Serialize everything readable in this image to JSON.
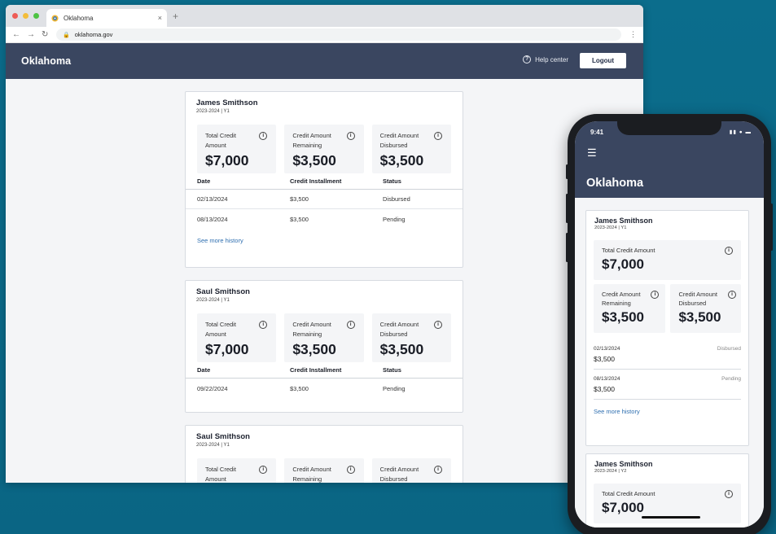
{
  "browser": {
    "tab_title": "Oklahoma",
    "tab_close": "×",
    "new_tab": "+",
    "url": "oklahoma.gov"
  },
  "header": {
    "brand": "Oklahoma",
    "help_label": "Help center",
    "logout_label": "Logout"
  },
  "labels": {
    "total_credit": "Total Credit Amount",
    "credit_remaining": "Credit Amount Remaining",
    "credit_disbursed": "Credit Amount Disbursed",
    "col_date": "Date",
    "col_installment": "Credit Installment",
    "col_status": "Status",
    "see_more": "See more history"
  },
  "cards": [
    {
      "name": "James Smithson",
      "sub": "2023-2024 | Y1",
      "total": "$7,000",
      "remaining": "$3,500",
      "disbursed": "$3,500",
      "rows": [
        {
          "date": "02/13/2024",
          "amount": "$3,500",
          "status": "Disbursed"
        },
        {
          "date": "08/13/2024",
          "amount": "$3,500",
          "status": "Pending"
        }
      ]
    },
    {
      "name": "Saul Smithson",
      "sub": "2023-2024 | Y1",
      "total": "$7,000",
      "remaining": "$3,500",
      "disbursed": "$3,500",
      "rows": [
        {
          "date": "09/22/2024",
          "amount": "$3,500",
          "status": "Pending"
        }
      ]
    },
    {
      "name": "Saul Smithson",
      "sub": "2023-2024 | Y1"
    }
  ],
  "phone": {
    "time": "9:41",
    "brand": "Oklahoma",
    "cards": [
      {
        "name": "James Smithson",
        "sub": "2023-2024 | Y1",
        "total": "$7,000",
        "remaining": "$3,500",
        "disbursed": "$3,500",
        "rows": [
          {
            "date": "02/13/2024",
            "amount": "$3,500",
            "status": "Disbursed"
          },
          {
            "date": "08/13/2024",
            "amount": "$3,500",
            "status": "Pending"
          }
        ]
      },
      {
        "name": "James Smithson",
        "sub": "2023-2024 | Y2",
        "total": "$7,000"
      }
    ]
  },
  "colors": {
    "header": "#3a4660",
    "link": "#2f6fb0",
    "background": "#0b6d8c"
  }
}
